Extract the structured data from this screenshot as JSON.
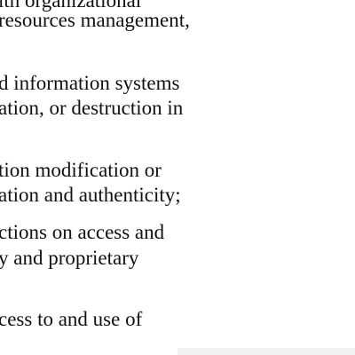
{
  "document": {
    "lines": [
      "ith organizational",
      "resources management,",
      "d information systems",
      "ation, or destruction in",
      "tion modification or",
      "ation and authenticity;",
      "ctions on access and",
      "y and proprietary",
      "cess to and use of"
    ]
  }
}
